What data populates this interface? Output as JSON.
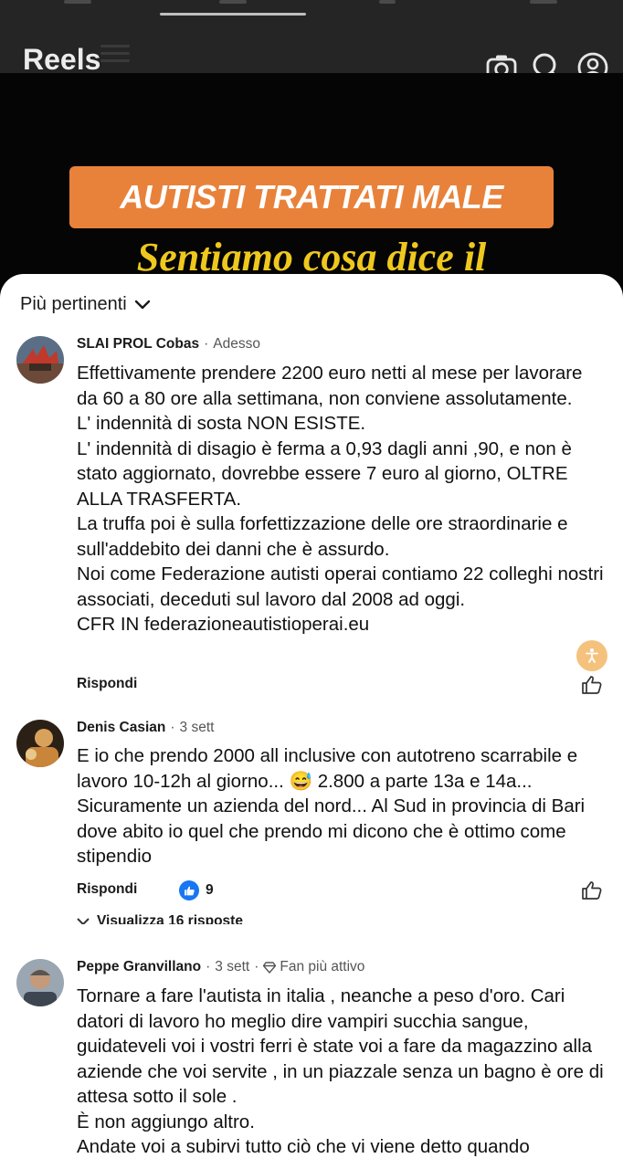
{
  "header": {
    "title": "Reels",
    "icons": [
      "menu-icon",
      "camera-icon",
      "search-icon",
      "profile-icon"
    ]
  },
  "video": {
    "banner_text": "AUTISTI TRATTATI MALE",
    "subtitle_text": "Sentiamo cosa dice il",
    "colors": {
      "banner": "#e8823a",
      "subtitle": "#efc81e"
    }
  },
  "comments_sheet": {
    "sort_label": "Più pertinenti",
    "comments": [
      {
        "author": "SLAI PROL Cobas",
        "time": "Adesso",
        "lines": [
          "Effettivamente prendere 2200 euro netti al mese per lavorare da 60 a 80 ore alla settimana, non conviene assolutamente.",
          "L' indennità di sosta NON ESISTE.",
          "L' indennità di disagio è ferma a 0,93 dagli anni ,90, e non è stato aggiornato, dovrebbe essere 7 euro al giorno, OLTRE ALLA TRASFERTA.",
          "La truffa poi è sulla forfettizzazione delle ore straordinarie e sull'addebito dei danni che è assurdo.",
          "Noi come Federazione autisti operai contiamo 22 colleghi nostri associati, deceduti sul lavoro dal 2008 ad oggi.",
          "CFR IN federazioneautistioperai.eu"
        ],
        "reply_label": "Rispondi"
      },
      {
        "author": "Denis Casian",
        "time": "3 sett",
        "lines": [
          "E io che prendo 2000 all inclusive con autotreno scarrabile e lavoro 10-12h al giorno... 😅 2.800 a parte 13a e 14a... Sicuramente un azienda del nord... Al Sud in provincia di Bari dove abito io quel che prendo mi dicono che è ottimo come stipendio"
        ],
        "reply_label": "Rispondi",
        "reaction_count": "9",
        "view_replies": "Visualizza 16 risposte"
      },
      {
        "author": "Peppe Granvillano",
        "time": "3 sett",
        "badge": "Fan più attivo",
        "lines": [
          "Tornare a fare l'autista in italia , neanche a peso d'oro. Cari datori di lavoro ho meglio dire vampiri succhia sangue, guidateveli voi i vostri ferri è state voi a fare da magazzino alla aziende che voi servite , in un piazzale senza un bagno è ore di attesa sotto il sole .",
          "È non aggiungo altro.",
          "Andate voi a subirvi tutto ciò che vi viene detto quando"
        ]
      }
    ]
  }
}
